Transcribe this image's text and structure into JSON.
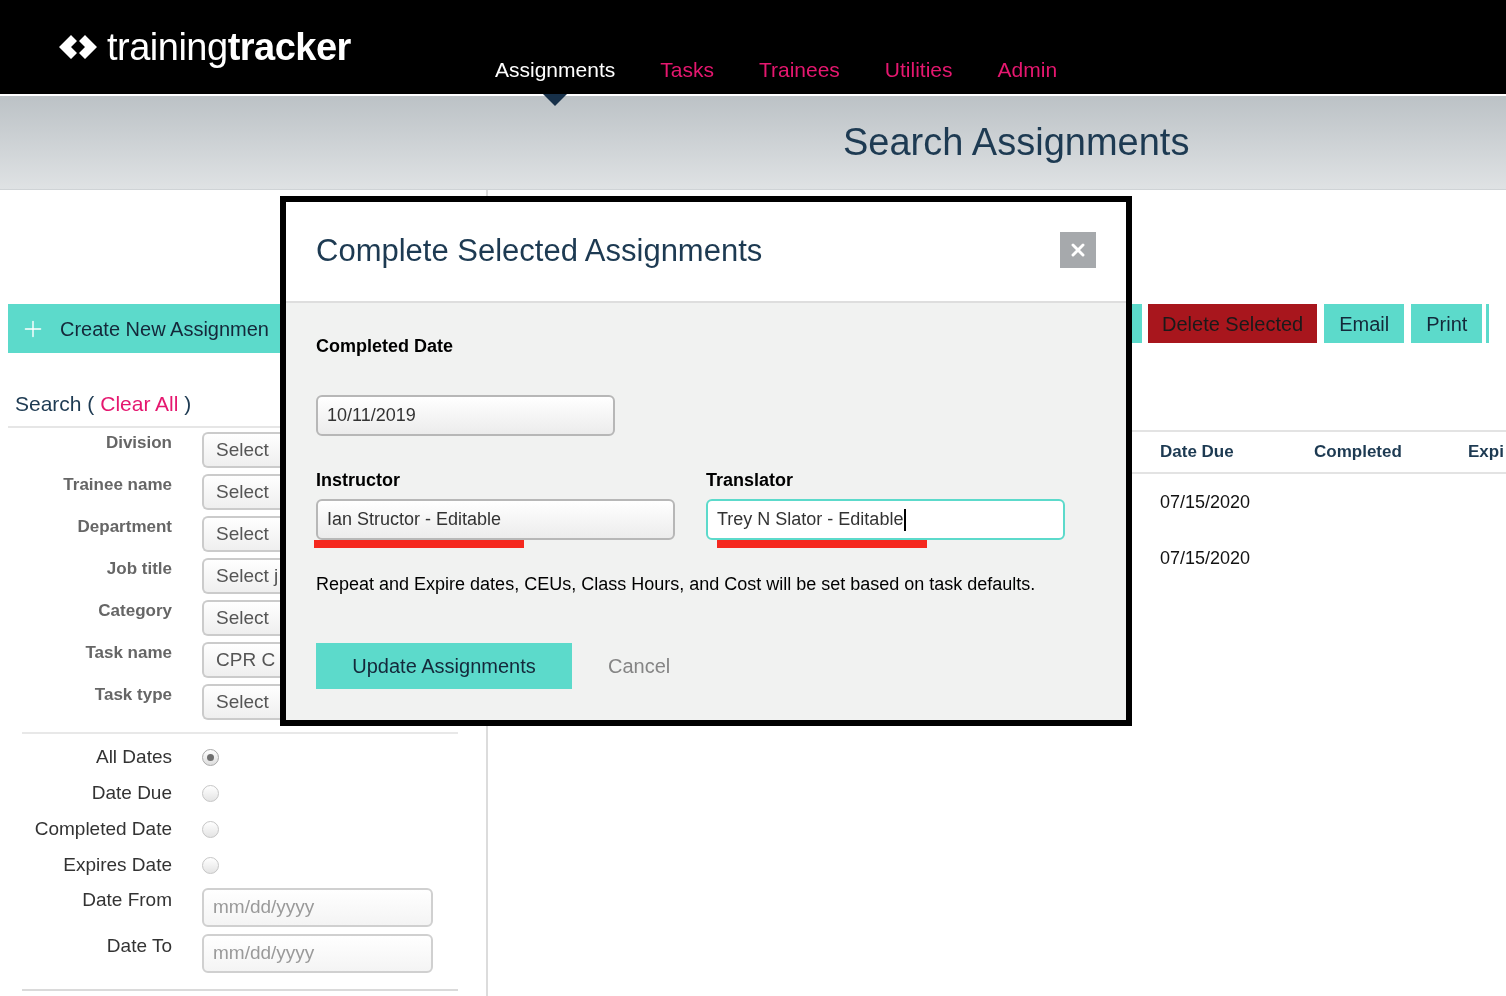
{
  "header": {
    "logo": "training**tracker**",
    "nav": [
      {
        "label": "Assignments",
        "selected": true
      },
      {
        "label": "Tasks",
        "selected": false
      },
      {
        "label": "Trainees",
        "selected": false
      },
      {
        "label": "Utilities",
        "selected": false
      },
      {
        "label": "Admin",
        "selected": false
      }
    ]
  },
  "page_title": "Search Assignments",
  "sidebar": {
    "create_button": "Create New Assignmen",
    "search": {
      "label": "Search (",
      "link": "Clear All",
      "end": ")"
    },
    "filters": [
      {
        "label": "Division",
        "value": "Select"
      },
      {
        "label": "Trainee name",
        "value": "Select"
      },
      {
        "label": "Department",
        "value": "Select"
      },
      {
        "label": "Job title",
        "value": "Select j"
      },
      {
        "label": "Category",
        "value": "Select"
      },
      {
        "label": "Task name",
        "value": "CPR C"
      },
      {
        "label": "Task type",
        "value": "Select"
      }
    ],
    "date_options": [
      {
        "label": "All Dates",
        "selected": true
      },
      {
        "label": "Date Due",
        "selected": false
      },
      {
        "label": "Completed Date",
        "selected": false
      },
      {
        "label": "Expires Date",
        "selected": false
      }
    ],
    "date_range": [
      {
        "label": "Date From",
        "placeholder": "mm/dd/yyyy"
      },
      {
        "label": "Date To",
        "placeholder": "mm/dd/yyyy"
      }
    ]
  },
  "toolbar": [
    {
      "kind": "partial"
    },
    {
      "kind": "danger",
      "label": "Delete Selected"
    },
    {
      "kind": "primary",
      "label": "Email"
    },
    {
      "kind": "primary",
      "label": "Print"
    },
    {
      "kind": "partial"
    }
  ],
  "table": {
    "columns": [
      "Date Due",
      "Completed",
      "Expi"
    ],
    "rows": [
      [
        "07/15/2020"
      ],
      [
        "07/15/2020"
      ]
    ]
  },
  "dialog": {
    "title": "Complete Selected Assignments",
    "date_label": "Completed Date",
    "date_value": "10/11/2019",
    "people": [
      {
        "label": "Instructor",
        "value": "Ian Structor - Editable",
        "focused": false,
        "underlined": true
      },
      {
        "label": "Translator",
        "value": "Trey N Slator - Editable",
        "focused": true,
        "underlined": true
      }
    ],
    "note": "Repeat and Expire dates, CEUs, Class Hours, and Cost will be set based on task defaults.",
    "submit": "Update Assignments",
    "cancel": "Cancel"
  }
}
